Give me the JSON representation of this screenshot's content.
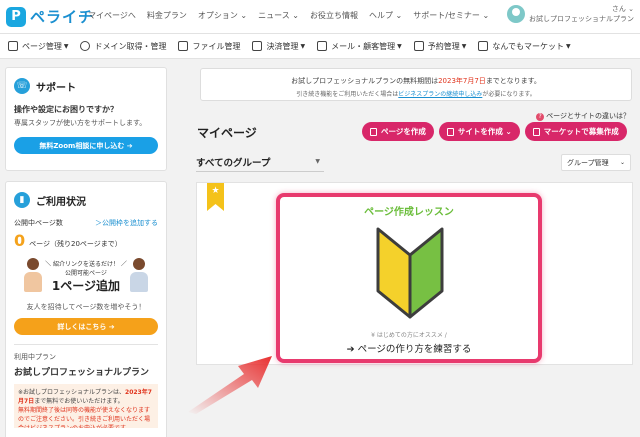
{
  "header": {
    "logo_mark": "P",
    "logo_text": "ペライチ",
    "nav": [
      "マイページへ",
      "料金プラン",
      "オプション ⌄",
      "ニュース ⌄",
      "お役立ち情報",
      "ヘルプ ⌄",
      "サポート/セミナー ⌄"
    ],
    "user_line1": "さん ⌄",
    "user_line2": "お試しプロフェッショナルプラン"
  },
  "subnav": [
    {
      "label": "ページ管理",
      "icon": "page-icon"
    },
    {
      "label": "ドメイン取得・管理",
      "icon": "globe-icon"
    },
    {
      "label": "ファイル管理",
      "icon": "file-icon"
    },
    {
      "label": "決済管理",
      "icon": "cart-icon"
    },
    {
      "label": "メール・顧客管理",
      "icon": "mail-icon"
    },
    {
      "label": "予約管理",
      "icon": "calendar-icon"
    },
    {
      "label": "なんでもマーケット",
      "icon": "market-icon"
    }
  ],
  "support": {
    "title": "サポート",
    "question": "操作や設定にお困りですか？",
    "desc": "専属スタッフが使い方をサポートします。",
    "zoom_button": "無料Zoom相談に申し込む ➔"
  },
  "usage": {
    "title": "ご利用状況",
    "published_label": "公開中ページ数",
    "add_link": "＞公開枠を追加する",
    "count": "0",
    "count_label": "ページ（残り20ページまで）",
    "promo_small": "＼ 紹介リンクを送るだけ！ ／",
    "promo_small2": "公開可能ページ",
    "promo_big": "1ページ追加",
    "promo_sub": "友人を招待してページ数を増やそう！",
    "detail_button": "詳しくはこちら ➔",
    "plan_label": "利用中プラン",
    "plan_name": "お試しプロフェッショナルプラン",
    "note_prefix": "※お試しプロフェッショナルプランは、",
    "note_date": "2023年7月7日",
    "note_mid": "まで無料でお使いいただけます。",
    "note_red": "無料期間終了後は同等の機能が使えなくなりますのでご注意ください。引き続きご利用いただく場合はビジネスプランのお申込が必要です。"
  },
  "notice": {
    "line1_prefix": "お試しプロフェッショナルプランの無料期間は",
    "line1_date": "2023年7月7日",
    "line1_suffix": "までとなります。",
    "line2_prefix": "引き続き機能をご利用いただく場合は",
    "line2_link": "ビジネスプランの継続申し込み",
    "line2_suffix": "が必要になります。"
  },
  "main": {
    "diff_link": "ページとサイトの違いは？",
    "title": "マイページ",
    "buttons": [
      "ページを作成",
      "サイトを作成 ⌄",
      "マーケットで募集作成"
    ],
    "group_select": "すべてのグループ",
    "group_mgmt": "グループ管理"
  },
  "lesson": {
    "title": "ページ作成レッスン",
    "hint": "¥ はじめての方にオススメ /",
    "cta": "ページの作り方を練習する",
    "leaf_colors": {
      "left": "#f4d12b",
      "right": "#77c043",
      "outline": "#3d3d3d"
    }
  },
  "colors": {
    "primary_pink": "#d82769",
    "highlight_frame": "#e83a6e",
    "blue": "#1aa0e6",
    "orange": "#f5a11a"
  }
}
